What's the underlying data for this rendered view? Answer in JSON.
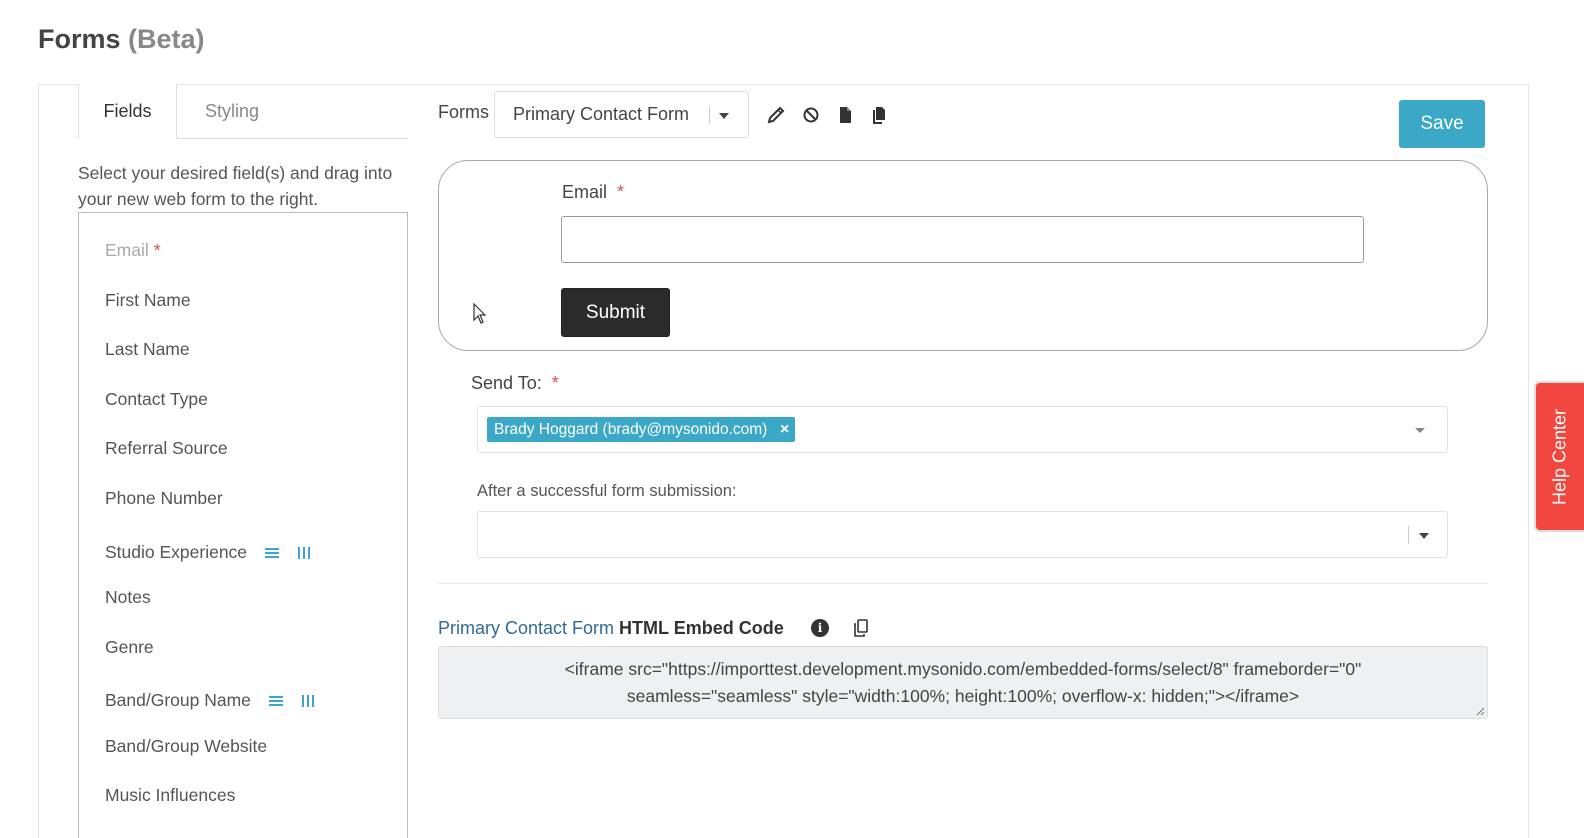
{
  "page": {
    "title": "Forms",
    "title_suffix": "(Beta)"
  },
  "tabs": [
    {
      "label": "Fields",
      "active": true
    },
    {
      "label": "Styling",
      "active": false
    }
  ],
  "sidebar": {
    "instructions": "Select your desired field(s) and drag into your new web form to the right.",
    "required_marker": "*",
    "fields": [
      {
        "label": "Email",
        "required": true,
        "disabled": true
      },
      {
        "label": "First Name"
      },
      {
        "label": "Last Name"
      },
      {
        "label": "Contact Type"
      },
      {
        "label": "Referral Source"
      },
      {
        "label": "Phone Number"
      },
      {
        "label": "Studio Experience",
        "layout_icons": [
          "list-rows-icon",
          "columns-icon"
        ]
      },
      {
        "label": "Notes"
      },
      {
        "label": "Genre"
      },
      {
        "label": "Band/Group Name",
        "layout_icons": [
          "list-rows-icon",
          "columns-icon"
        ]
      },
      {
        "label": "Band/Group Website"
      },
      {
        "label": "Music Influences"
      }
    ]
  },
  "toolbar": {
    "forms_label": "Forms",
    "selected_form": "Primary Contact Form",
    "icons": [
      "pencil-icon",
      "ban-icon",
      "file-icon",
      "copy-icon"
    ],
    "save_label": "Save"
  },
  "preview": {
    "email_label": "Email",
    "required_marker": "*",
    "email_value": "",
    "submit_label": "Submit"
  },
  "send_to": {
    "label": "Send To:",
    "required_marker": "*",
    "recipients": [
      {
        "label": "Brady Hoggard (brady@mysonido.com)",
        "remove": "×"
      }
    ]
  },
  "after_submission": {
    "label": "After a successful form submission:",
    "selected": ""
  },
  "embed": {
    "form_link": "Primary Contact Form",
    "title": "HTML Embed Code",
    "info_glyph": "i",
    "code_line1": "<iframe src=\"https://importtest.development.mysonido.com/embedded-forms/select/8\" frameborder=\"0\"",
    "code_line2": "seamless=\"seamless\" style=\"width:100%; height:100%; overflow-x: hidden;\"></iframe>"
  },
  "help_center": {
    "label": "Help Center",
    "color": "#f2473f"
  },
  "colors": {
    "accent": "#3ba8c8",
    "required": "#d9534f",
    "link": "#2f6a9b",
    "submit_bg": "#2b2b2b"
  }
}
